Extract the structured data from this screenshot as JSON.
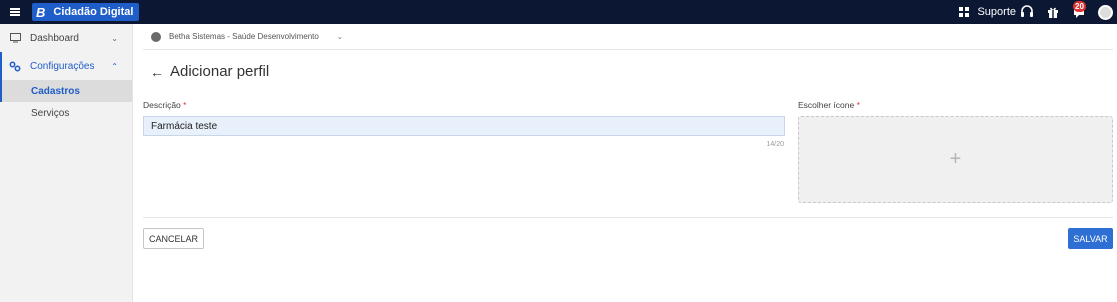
{
  "topbar": {
    "brand_letter": "B",
    "brand_name": "Cidadão Digital",
    "support_label": "Suporte",
    "notification_count": "20"
  },
  "sidebar": {
    "items": [
      {
        "label": "Dashboard",
        "icon": "monitor-icon"
      },
      {
        "label": "Configurações",
        "icon": "gears-icon",
        "children": [
          {
            "label": "Cadastros"
          },
          {
            "label": "Serviços"
          }
        ]
      }
    ]
  },
  "entity": {
    "name": "Betha Sistemas - Saúde Desenvolvimento"
  },
  "page": {
    "title": "Adicionar perfil"
  },
  "form": {
    "description_label": "Descrição",
    "required_mark": "*",
    "description_value": "Farmácia teste",
    "counter": "14/20",
    "icon_label": "Escolher ícone",
    "cancel_label": "CANCELAR",
    "save_label": "SALVAR"
  },
  "colors": {
    "topbar": "#0b1733",
    "accent": "#1f5dc9",
    "primary_button": "#2d6fd2"
  }
}
